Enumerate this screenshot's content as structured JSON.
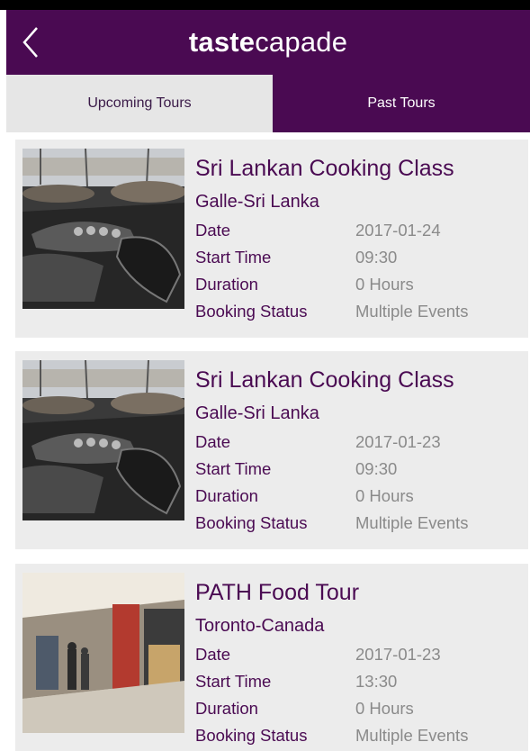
{
  "header": {
    "brand_bold": "taste",
    "brand_light": "capade"
  },
  "tabs": [
    {
      "label": "Upcoming Tours",
      "active": true
    },
    {
      "label": "Past Tours",
      "active": false
    }
  ],
  "labels": {
    "date": "Date",
    "start_time": "Start Time",
    "duration": "Duration",
    "booking_status": "Booking Status"
  },
  "tours": [
    {
      "title": "Sri Lankan Cooking Class",
      "location": "Galle-Sri Lanka",
      "date": "2017-01-24",
      "start_time": "09:30",
      "duration": "0 Hours",
      "booking_status": "Multiple Events"
    },
    {
      "title": "Sri Lankan Cooking Class",
      "location": "Galle-Sri Lanka",
      "date": "2017-01-23",
      "start_time": "09:30",
      "duration": "0 Hours",
      "booking_status": "Multiple Events"
    },
    {
      "title": "PATH Food Tour",
      "location": "Toronto-Canada",
      "date": "2017-01-23",
      "start_time": "13:30",
      "duration": "0 Hours",
      "booking_status": "Multiple Events"
    }
  ],
  "colors": {
    "primary": "#4a0a52",
    "tab_inactive_bg": "#e6e6e6",
    "card_bg": "#ececec",
    "value_text": "#8a8a8a"
  },
  "icons": {
    "back": "chevron-left-icon"
  }
}
